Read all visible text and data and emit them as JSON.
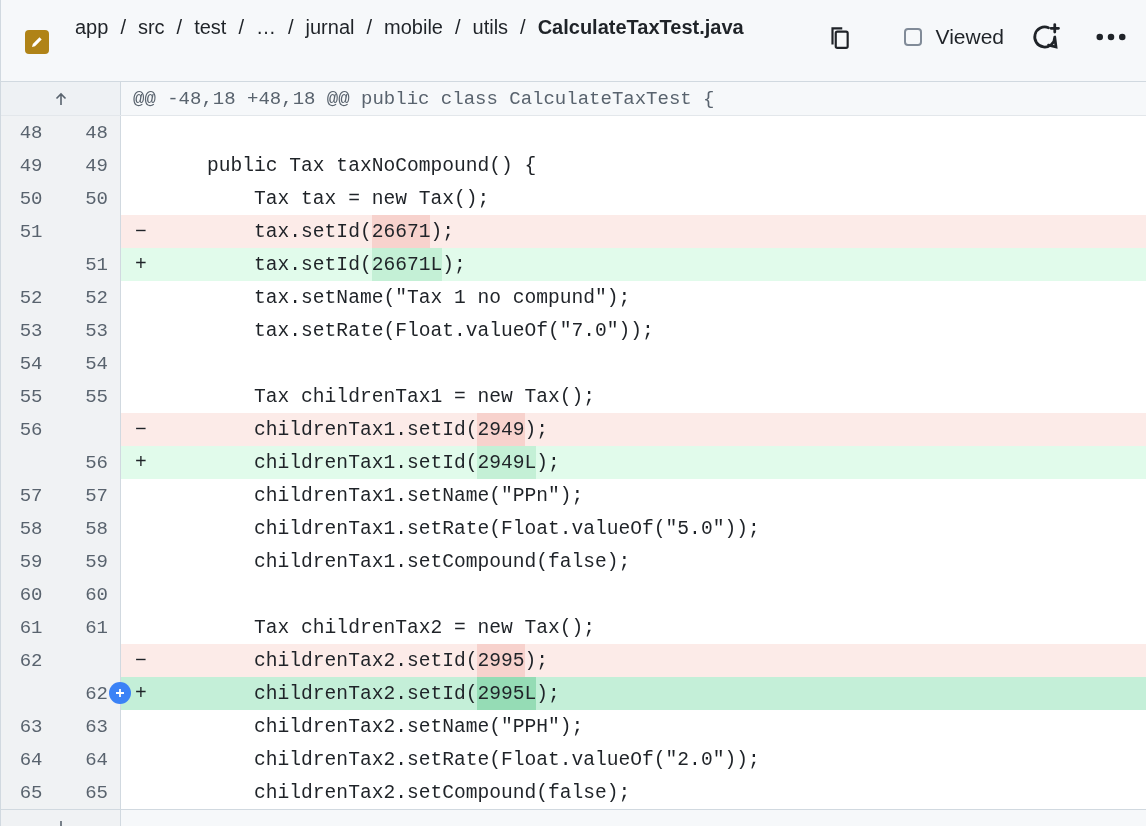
{
  "file_header": {
    "path": [
      "app",
      "src",
      "test",
      "…",
      "jurnal",
      "mobile",
      "utils"
    ],
    "separator": "/",
    "filename": "CalculateTaxTest.java",
    "viewed": {
      "label": "Viewed",
      "checked": false
    }
  },
  "hunk_header": "@@ -48,18 +48,18 @@ public class CalculateTaxTest {",
  "lines": [
    {
      "kind": "context",
      "old": "48",
      "new": "48",
      "hovered": false
    },
    {
      "kind": "context",
      "old": "49",
      "new": "49",
      "hovered": false,
      "code": [
        {
          "text": "    public Tax taxNoCompound() {"
        }
      ]
    },
    {
      "kind": "context",
      "old": "50",
      "new": "50",
      "hovered": false,
      "code": [
        {
          "text": "        Tax tax = new Tax();"
        }
      ]
    },
    {
      "kind": "deletion",
      "old": "51",
      "marker": "−",
      "hovered": false,
      "code": [
        {
          "text": "        tax.setId(",
          "changed": false
        },
        {
          "text": "26671",
          "changed": true
        },
        {
          "text": ");",
          "changed": false
        }
      ]
    },
    {
      "kind": "addition",
      "new": "51",
      "marker": "+",
      "hovered": false,
      "code": [
        {
          "text": "        tax.setId(",
          "changed": false
        },
        {
          "text": "26671L",
          "changed": true
        },
        {
          "text": ");",
          "changed": false
        }
      ]
    },
    {
      "kind": "context",
      "old": "52",
      "new": "52",
      "hovered": false,
      "code": [
        {
          "text": "        tax.setName(\"Tax 1 no compund\");"
        }
      ]
    },
    {
      "kind": "context",
      "old": "53",
      "new": "53",
      "hovered": false,
      "code": [
        {
          "text": "        tax.setRate(Float.valueOf(\"7.0\"));"
        }
      ]
    },
    {
      "kind": "context",
      "old": "54",
      "new": "54",
      "hovered": false
    },
    {
      "kind": "context",
      "old": "55",
      "new": "55",
      "hovered": false,
      "code": [
        {
          "text": "        Tax childrenTax1 = new Tax();"
        }
      ]
    },
    {
      "kind": "deletion",
      "old": "56",
      "marker": "−",
      "hovered": false,
      "code": [
        {
          "text": "        childrenTax1.setId(",
          "changed": false
        },
        {
          "text": "2949",
          "changed": true
        },
        {
          "text": ");",
          "changed": false
        }
      ]
    },
    {
      "kind": "addition",
      "new": "56",
      "marker": "+",
      "hovered": false,
      "code": [
        {
          "text": "        childrenTax1.setId(",
          "changed": false
        },
        {
          "text": "2949L",
          "changed": true
        },
        {
          "text": ");",
          "changed": false
        }
      ]
    },
    {
      "kind": "context",
      "old": "57",
      "new": "57",
      "hovered": false,
      "code": [
        {
          "text": "        childrenTax1.setName(\"PPn\");"
        }
      ]
    },
    {
      "kind": "context",
      "old": "58",
      "new": "58",
      "hovered": false,
      "code": [
        {
          "text": "        childrenTax1.setRate(Float.valueOf(\"5.0\"));"
        }
      ]
    },
    {
      "kind": "context",
      "old": "59",
      "new": "59",
      "hovered": false,
      "code": [
        {
          "text": "        childrenTax1.setCompound(false);"
        }
      ]
    },
    {
      "kind": "context",
      "old": "60",
      "new": "60",
      "hovered": false
    },
    {
      "kind": "context",
      "old": "61",
      "new": "61",
      "hovered": false,
      "code": [
        {
          "text": "        Tax childrenTax2 = new Tax();"
        }
      ]
    },
    {
      "kind": "deletion",
      "old": "62",
      "marker": "−",
      "hovered": false,
      "code": [
        {
          "text": "        childrenTax2.setId(",
          "changed": false
        },
        {
          "text": "2995",
          "changed": true
        },
        {
          "text": ");",
          "changed": false
        }
      ]
    },
    {
      "kind": "addition",
      "new": "62",
      "marker": "+",
      "hovered": true,
      "code": [
        {
          "text": "        childrenTax2.setId(",
          "changed": false
        },
        {
          "text": "2995L",
          "changed": true
        },
        {
          "text": ");",
          "changed": false
        }
      ]
    },
    {
      "kind": "context",
      "old": "63",
      "new": "63",
      "hovered": false,
      "code": [
        {
          "text": "        childrenTax2.setName(\"PPH\");"
        }
      ]
    },
    {
      "kind": "context",
      "old": "64",
      "new": "64",
      "hovered": false,
      "code": [
        {
          "text": "        childrenTax2.setRate(Float.valueOf(\"2.0\"));"
        }
      ]
    },
    {
      "kind": "context",
      "old": "65",
      "new": "65",
      "hovered": false,
      "code": [
        {
          "text": "        childrenTax2.setCompound(false);"
        }
      ]
    }
  ]
}
